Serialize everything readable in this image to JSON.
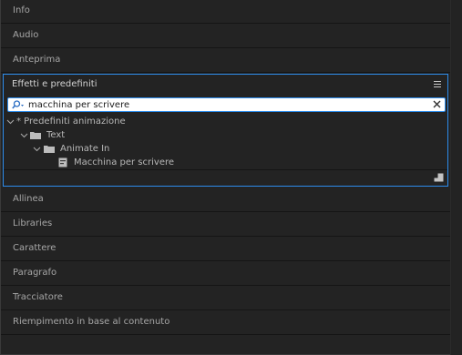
{
  "panels_above": [
    {
      "label": "Info"
    },
    {
      "label": "Audio"
    },
    {
      "label": "Anteprima"
    }
  ],
  "effects_panel": {
    "title": "Effetti e predefiniti",
    "search": {
      "value": "macchina per scrivere",
      "placeholder": ""
    },
    "tree": [
      {
        "label": "* Predefiniti animazione",
        "level": 0,
        "type": "category",
        "expanded": true
      },
      {
        "label": "Text",
        "level": 1,
        "type": "folder",
        "expanded": true
      },
      {
        "label": "Animate In",
        "level": 2,
        "type": "folder",
        "expanded": true
      },
      {
        "label": "Macchina per scrivere",
        "level": 3,
        "type": "preset"
      }
    ]
  },
  "panels_below": [
    {
      "label": "Allinea"
    },
    {
      "label": "Libraries"
    },
    {
      "label": "Carattere"
    },
    {
      "label": "Paragrafo"
    },
    {
      "label": "Tracciatore"
    },
    {
      "label": "Riempimento in base al contenuto"
    }
  ],
  "colors": {
    "background": "#232323",
    "focus_border": "#2d8ceb",
    "text": "#a8a8a8"
  }
}
